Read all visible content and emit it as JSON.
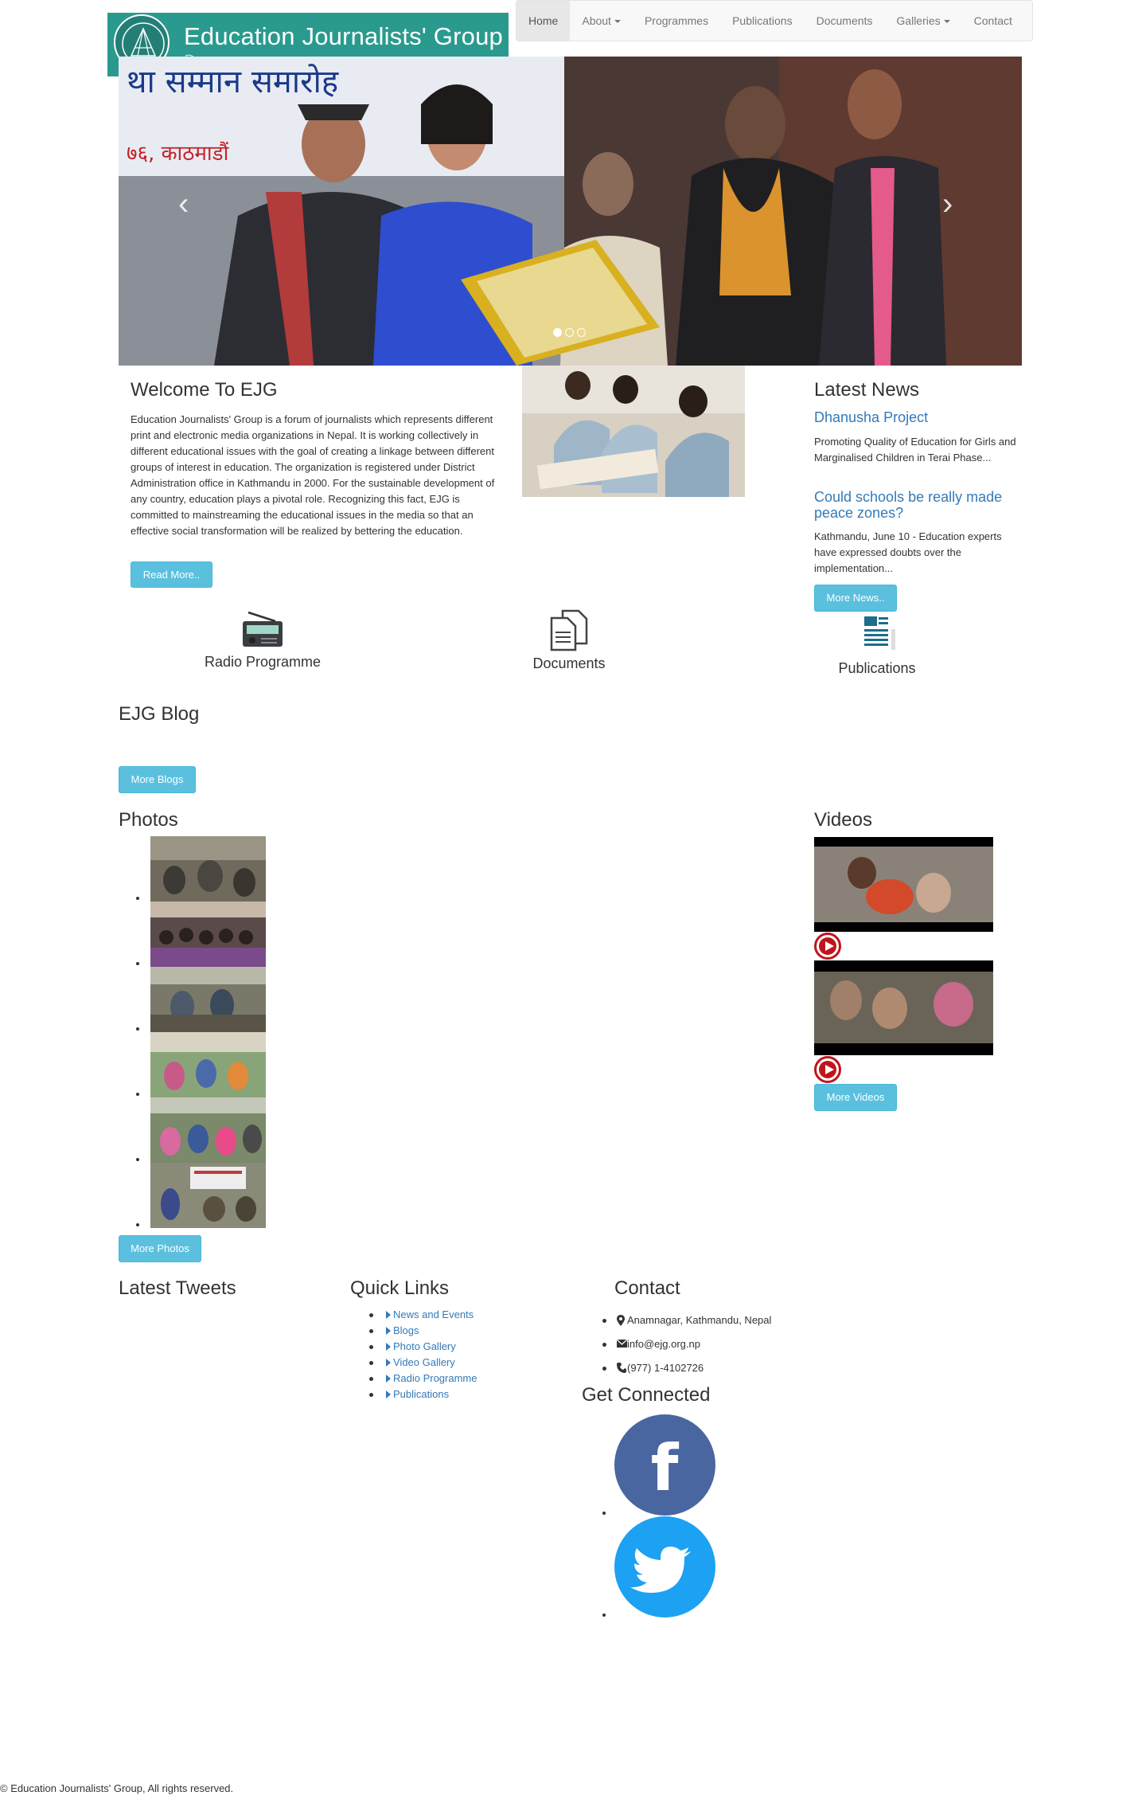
{
  "header": {
    "logo_title": "Education Journalists' Group",
    "logo_subtitle": "शिक्षा पत्रकार समूह",
    "nav": [
      {
        "label": "Home",
        "active": true
      },
      {
        "label": "About",
        "dropdown": true
      },
      {
        "label": "Programmes"
      },
      {
        "label": "Publications"
      },
      {
        "label": "Documents"
      },
      {
        "label": "Galleries",
        "dropdown": true
      },
      {
        "label": "Contact"
      }
    ]
  },
  "carousel": {
    "banner_text": "था सम्मान समारोह",
    "banner_text2": "७६, काठमाडौं",
    "prev_label": "‹",
    "next_label": "›",
    "slides": 3,
    "active_slide": 1
  },
  "welcome": {
    "title": "Welcome To EJG",
    "text": "Education Journalists' Group is a forum of journalists which represents different print and electronic media organizations in Nepal. It is working collectively in different educational issues with the goal of creating a linkage between different groups of interest in education. The organization is registered under District Administration office in Kathmandu in 2000. For the sustainable development of any country, education plays a pivotal role. Recognizing this fact, EJG is committed to mainstreaming the educational issues in the media so that an effective social transformation will be realized by bettering the education.",
    "button": "Read More.."
  },
  "news": {
    "title": "Latest News",
    "items": [
      {
        "title": "Dhanusha Project",
        "text": "Promoting Quality of Education for Girls and Marginalised Children in Terai Phase..."
      },
      {
        "title": "Could schools be really made peace zones?",
        "text": "Kathmandu, June 10 - Education experts have expressed doubts over the implementation..."
      }
    ],
    "button": "More News.."
  },
  "features": [
    {
      "label": "Radio Programme",
      "icon": "radio-icon"
    },
    {
      "label": "Documents",
      "icon": "documents-icon"
    },
    {
      "label": "Publications",
      "icon": "publications-icon"
    }
  ],
  "blog": {
    "title": "EJG Blog",
    "button": "More Blogs"
  },
  "photos": {
    "title": "Photos",
    "count": 6,
    "button": "More Photos"
  },
  "videos": {
    "title": "Videos",
    "count": 2,
    "button": "More Videos"
  },
  "footer": {
    "tweets_title": "Latest Tweets",
    "quick_links_title": "Quick Links",
    "quick_links": [
      "News and Events",
      "Blogs",
      "Photo Gallery",
      "Video Gallery",
      "Radio Programme",
      "Publications"
    ],
    "contact_title": "Contact",
    "contact": [
      {
        "icon": "map-marker-icon",
        "text": "Anamnagar, Kathmandu, Nepal"
      },
      {
        "icon": "envelope-icon",
        "text": "info@ejg.org.np"
      },
      {
        "icon": "phone-icon",
        "text": "(977) 1-4102726"
      }
    ],
    "connect_title": "Get Connected",
    "facebook_letter": "f",
    "social": [
      {
        "name": "facebook",
        "color": "#4a66a0"
      },
      {
        "name": "twitter",
        "color": "#1da1f2"
      }
    ],
    "copyright": "© Education Journalists' Group, All rights reserved."
  },
  "colors": {
    "accent": "#5bc0de",
    "link": "#337ab7",
    "logo_bg": "#2a9a8e"
  }
}
